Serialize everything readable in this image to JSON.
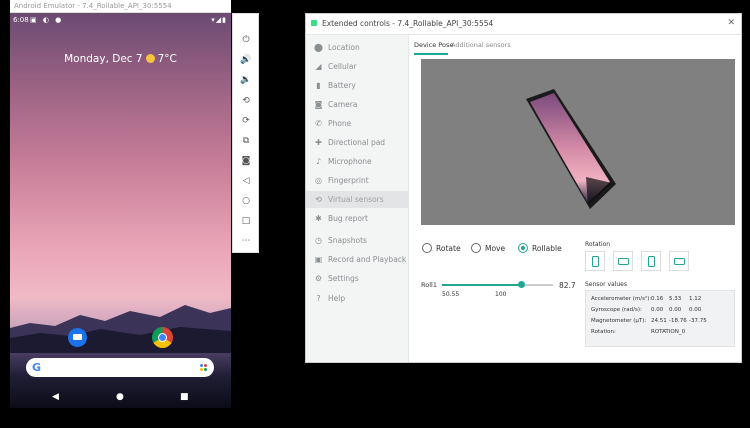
{
  "emulator": {
    "title": "Android Emulator - 7.4_Rollable_API_30:5554",
    "status_time": "6:08",
    "date_weather": "Monday, Dec 7",
    "temperature": "7°C",
    "toolbar_icons": [
      "power-icon",
      "volume-up-icon",
      "volume-down-icon",
      "rotate-left-icon",
      "rotate-right-icon",
      "fold-icon",
      "camera-icon",
      "back-icon",
      "home-icon",
      "overview-icon",
      "more-icon"
    ]
  },
  "ext": {
    "title": "Extended controls - 7.4_Rollable_API_30:5554",
    "sidebar": [
      {
        "label": "Location",
        "icon": "location-icon"
      },
      {
        "label": "Cellular",
        "icon": "cellular-icon"
      },
      {
        "label": "Battery",
        "icon": "battery-icon"
      },
      {
        "label": "Camera",
        "icon": "camera-icon"
      },
      {
        "label": "Phone",
        "icon": "phone-icon"
      },
      {
        "label": "Directional pad",
        "icon": "dpad-icon"
      },
      {
        "label": "Microphone",
        "icon": "microphone-icon"
      },
      {
        "label": "Fingerprint",
        "icon": "fingerprint-icon"
      },
      {
        "label": "Virtual sensors",
        "icon": "virtual-sensors-icon",
        "active": true
      },
      {
        "label": "Bug report",
        "icon": "bug-icon"
      },
      {
        "label": "Snapshots",
        "icon": "snapshots-icon"
      },
      {
        "label": "Record and Playback",
        "icon": "record-icon"
      },
      {
        "label": "Settings",
        "icon": "settings-icon"
      },
      {
        "label": "Help",
        "icon": "help-icon"
      }
    ],
    "tabs": {
      "device_pose": "Device Pose",
      "additional": "Additional sensors"
    },
    "modes": {
      "rotate": "Rotate",
      "move": "Move",
      "rollable": "Rollable",
      "selected": "rollable"
    },
    "rotation_label": "Rotation",
    "roll": {
      "label": "Roll1",
      "value": "82.7",
      "min": "50.55",
      "max": "100",
      "fraction": 0.72
    },
    "sensor_title": "Sensor values",
    "sensors": {
      "accel_label": "Accelerometer (m/s²):",
      "accel": [
        "0.16",
        "5.33",
        "1.12"
      ],
      "gyro_label": "Gyroscope (rad/s):",
      "gyro": [
        "0.00",
        "0.00",
        "0.00"
      ],
      "mag_label": "Magnetometer (μT):",
      "mag": [
        "24.51",
        "-18.76",
        "-37.75"
      ],
      "rot_label": "Rotation:",
      "rot": "ROTATION_0"
    }
  },
  "colors": {
    "accent": "#23a691"
  }
}
